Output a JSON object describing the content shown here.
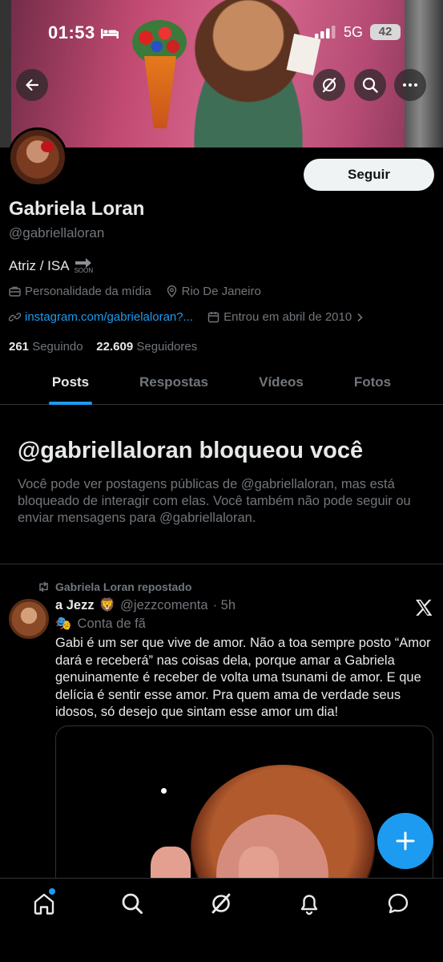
{
  "status_bar": {
    "time": "01:53",
    "network": "5G",
    "battery": "42"
  },
  "header": {
    "back_icon": "arrow-left-icon",
    "grok_icon": "grok-icon",
    "search_icon": "search-icon",
    "more_icon": "more-icon"
  },
  "profile": {
    "follow_label": "Seguir",
    "name": "Gabriela Loran",
    "handle": "@gabriellaloran",
    "bio": "Atriz / ISA",
    "bio_badge": "SOON",
    "category": "Personalidade da mídia",
    "location": "Rio De Janeiro",
    "link": "instagram.com/gabrielaloran?...",
    "joined": "Entrou em abril de 2010",
    "following_count": "261",
    "following_label": "Seguindo",
    "followers_count": "22.609",
    "followers_label": "Seguidores"
  },
  "tabs": [
    {
      "label": "Posts",
      "active": true
    },
    {
      "label": "Respostas",
      "active": false
    },
    {
      "label": "Vídeos",
      "active": false
    },
    {
      "label": "Fotos",
      "active": false
    }
  ],
  "blocked": {
    "title": "@gabriellaloran bloqueou você",
    "text": "Você pode ver postagens públicas de @gabriellaloran, mas está bloqueado de interagir com elas. Você também não pode seguir ou enviar mensagens para @gabriellaloran."
  },
  "post": {
    "repost_label": "Gabriela Loran repostado",
    "author": "a Jezz",
    "author_emoji": "🦁",
    "handle": "@jezzcomenta",
    "time": "· 5h",
    "fan_emoji": "🎭",
    "fan_label": "Conta de fã",
    "text": "Gabi é um ser que vive de amor. Não a toa sempre posto “Amor dará e receberá” nas coisas dela, porque amar a Gabriela genuinamente é receber de volta uma tsunami de amor. E que delícia é sentir esse amor. Pra quem ama de verdade seus idosos, só desejo que sintam esse amor um dia!"
  },
  "bottom_nav": [
    "home-icon",
    "search-icon",
    "grok-icon",
    "notifications-icon",
    "messages-icon"
  ],
  "colors": {
    "accent": "#1d9bf0",
    "background": "#000000",
    "text": "#e7e9ea",
    "muted": "#71767b",
    "border": "#2f3336"
  }
}
